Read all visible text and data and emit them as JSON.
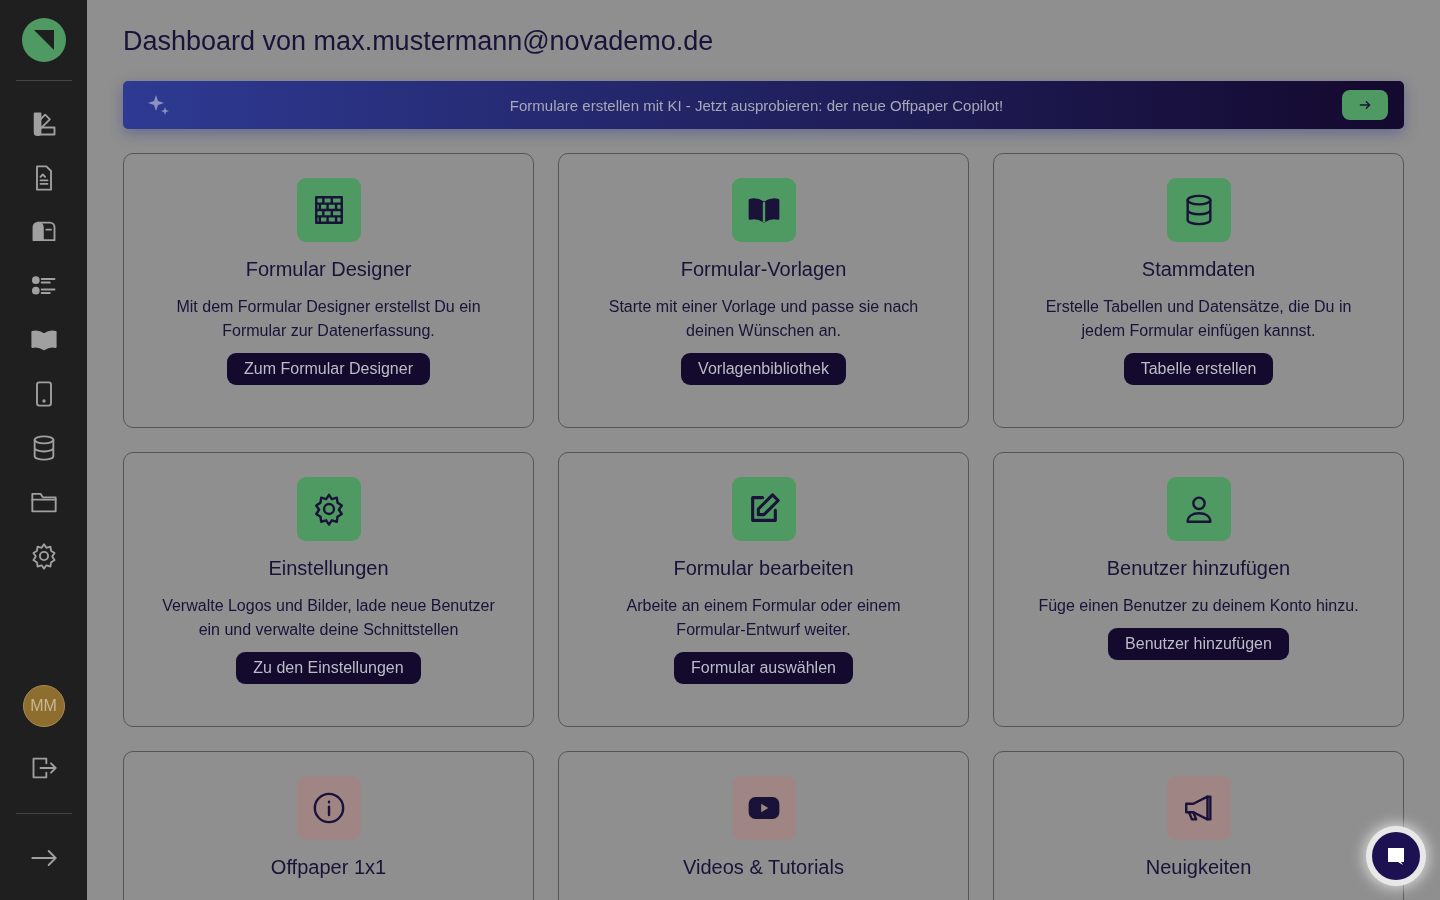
{
  "title": "Dashboard von max.mustermann@novademo.de",
  "banner": {
    "text": "Formulare erstellen mit KI - Jetzt ausprobieren: der neue Offpaper Copilot!"
  },
  "user": {
    "initials": "MM"
  },
  "cards": [
    {
      "title": "Formular Designer",
      "description": "Mit dem Formular Designer erstellst Du ein Formular zur Datenerfassung.",
      "button": "Zum Formular Designer",
      "color": "#4f9a63"
    },
    {
      "title": "Formular-Vorlagen",
      "description": "Starte mit einer Vorlage und passe sie nach deinen Wünschen an.",
      "button": "Vorlagenbibliothek",
      "color": "#4f9a63"
    },
    {
      "title": "Stammdaten",
      "description": "Erstelle Tabellen und Datensätze, die Du in jedem Formular einfügen kannst.",
      "button": "Tabelle erstellen",
      "color": "#4f9a63"
    },
    {
      "title": "Einstellungen",
      "description": "Verwalte Logos und Bilder, lade neue Benutzer ein und verwalte deine Schnittstellen",
      "button": "Zu den Einstellungen",
      "color": "#4f9a63"
    },
    {
      "title": "Formular bearbeiten",
      "description": "Arbeite an einem Formular oder einem Formular-Entwurf weiter.",
      "button": "Formular auswählen",
      "color": "#4f9a63"
    },
    {
      "title": "Benutzer hinzufügen",
      "description": "Füge einen Benutzer zu deinem Konto hinzu.",
      "button": "Benutzer hinzufügen",
      "color": "#4f9a63"
    },
    {
      "title": "Offpaper 1x1",
      "color": "#a08585"
    },
    {
      "title": "Videos & Tutorials",
      "color": "#a08585"
    },
    {
      "title": "Neuigkeiten",
      "color": "#a08585"
    }
  ]
}
